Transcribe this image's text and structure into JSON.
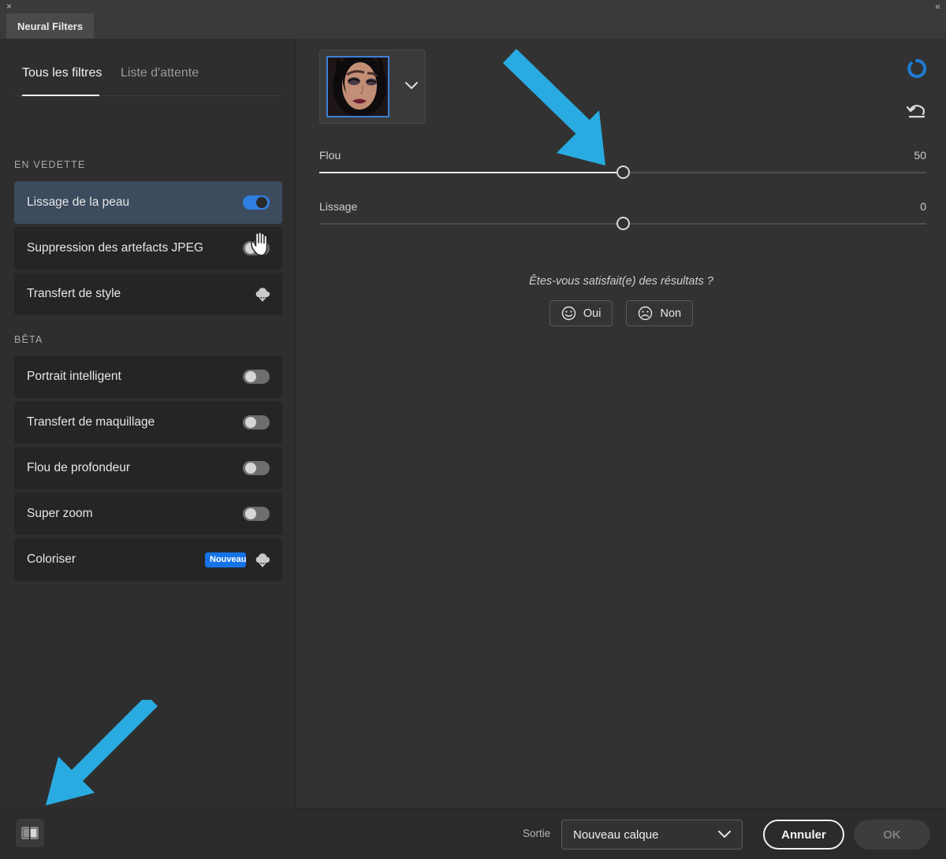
{
  "window": {
    "close_icon": "close-icon",
    "collapse_icon": "collapse-icon",
    "collapse_glyph": "«",
    "close_glyph": "×",
    "tab_label": "Neural Filters"
  },
  "sidebar": {
    "subtabs": [
      {
        "label": "Tous les filtres",
        "active": true
      },
      {
        "label": "Liste d'attente",
        "active": false
      }
    ],
    "groups": [
      {
        "label": "EN VEDETTE",
        "items": [
          {
            "name": "Lissage de la peau",
            "control": "toggle",
            "toggle_on": true,
            "selected": true
          },
          {
            "name": "Suppression des artefacts JPEG",
            "control": "toggle",
            "toggle_on": false,
            "selected": false
          },
          {
            "name": "Transfert de style",
            "control": "cloud",
            "selected": false
          }
        ]
      },
      {
        "label": "BÊTA",
        "items": [
          {
            "name": "Portrait intelligent",
            "control": "toggle",
            "toggle_on": false,
            "selected": false
          },
          {
            "name": "Transfert de maquillage",
            "control": "toggle",
            "toggle_on": false,
            "selected": false
          },
          {
            "name": "Flou de profondeur",
            "control": "toggle",
            "toggle_on": false,
            "selected": false
          },
          {
            "name": "Super zoom",
            "control": "toggle",
            "toggle_on": false,
            "selected": false
          },
          {
            "name": "Coloriser",
            "control": "cloud",
            "badge": "Nouveau",
            "selected": false
          }
        ]
      }
    ]
  },
  "main": {
    "thumbnail": {
      "name": "face-thumbnail",
      "selected": true
    },
    "thumbnail_chevron": "chevron-down-icon",
    "spinner": "loading-spinner",
    "reset": "reset-icon",
    "sliders": [
      {
        "label": "Flou",
        "value": "50",
        "percent": 50
      },
      {
        "label": "Lissage",
        "value": "0",
        "percent": 50
      }
    ],
    "feedback": {
      "question": "Êtes-vous satisfait(e) des résultats ?",
      "yes_label": "Oui",
      "no_label": "Non",
      "yes_icon": "smiley-face-icon",
      "no_icon": "frowny-face-icon"
    }
  },
  "bottom": {
    "preview_toggle_icon": "before-after-preview-icon",
    "output_label": "Sortie",
    "output_value": "Nouveau calque",
    "output_chevron": "chevron-down-icon",
    "cancel_label": "Annuler",
    "ok_label": "OK"
  },
  "annotations": {
    "arrow_color": "#29ABE2",
    "arrows": [
      {
        "name": "arrow-to-flou-slider",
        "points_to": "flou-slider-thumb"
      },
      {
        "name": "arrow-to-preview-toggle",
        "points_to": "preview-toggle-button"
      }
    ]
  },
  "colors": {
    "accent_blue": "#1473e6",
    "toggle_on": "#2f7fe0",
    "selected_row": "#3c4b5e",
    "panel_bg": "#323232",
    "sidebar_bg": "#2e2e2e"
  }
}
